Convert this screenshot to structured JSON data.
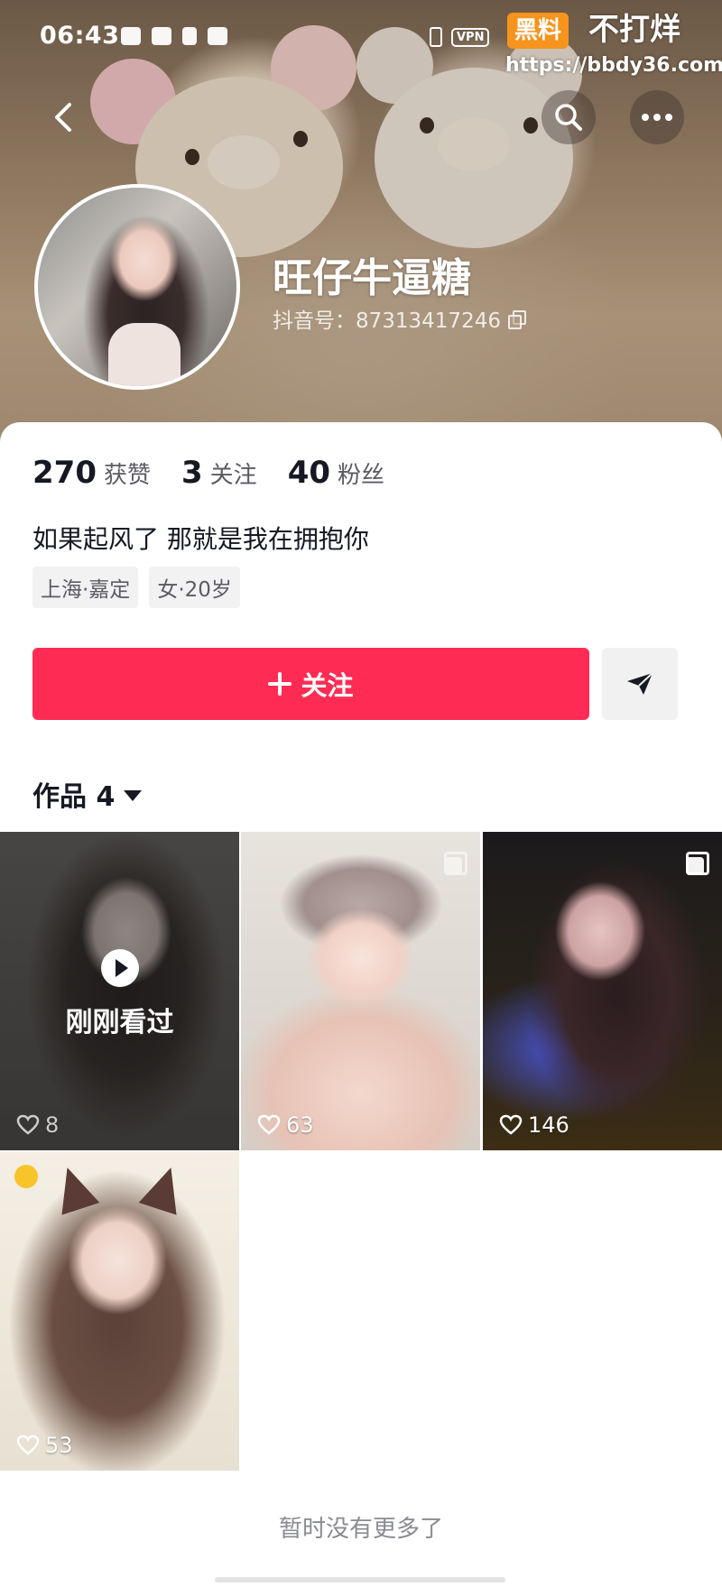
{
  "status_bar": {
    "time": "06:43",
    "vpn_label": "VPN"
  },
  "watermark": {
    "badge": "黑料",
    "text": "不打烊",
    "url": "https://bbdy36.com"
  },
  "profile": {
    "nickname": "旺仔牛逼糖",
    "douyin_id": "抖音号：87313417246",
    "stats": [
      {
        "num": "270",
        "label": "获赞"
      },
      {
        "num": "3",
        "label": "关注"
      },
      {
        "num": "40",
        "label": "粉丝"
      }
    ],
    "bio": "如果起风了 那就是我在拥抱你",
    "tags": [
      "上海·嘉定",
      "女·20岁"
    ]
  },
  "actions": {
    "follow_label": "关注"
  },
  "works": {
    "tab_label": "作品 4",
    "items": [
      {
        "likes": "8",
        "overlay": "刚刚看过"
      },
      {
        "likes": "63"
      },
      {
        "likes": "146"
      },
      {
        "likes": "53"
      }
    ],
    "footer": "暂时没有更多了"
  },
  "colors": {
    "accent": "#fe2c55",
    "text_primary": "#161823",
    "text_secondary": "#5b5b63"
  },
  "icons": [
    "back-icon",
    "search-icon",
    "more-icon",
    "copy-icon",
    "plus-icon",
    "share-icon",
    "caret-down-icon",
    "heart-icon",
    "play-icon",
    "multi-image-icon"
  ]
}
